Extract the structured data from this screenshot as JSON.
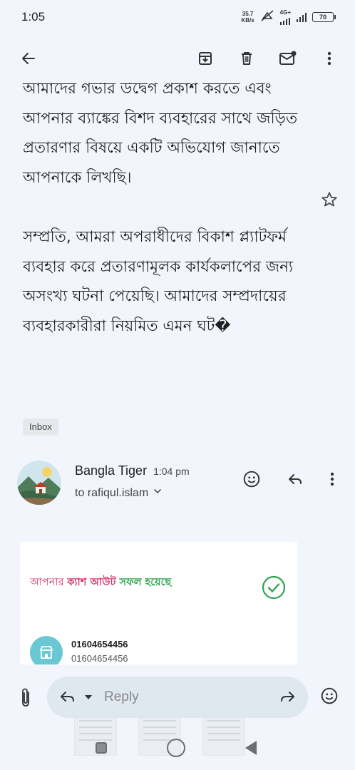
{
  "status_bar": {
    "time": "1:05",
    "net_speed_value": "35.7",
    "net_speed_unit": "KB/s",
    "network_type": "4G+",
    "battery": "70",
    "icons": [
      "mute-icon",
      "signal-4g-icon",
      "signal-icon",
      "battery-icon"
    ]
  },
  "app_bar": {
    "icons": [
      "back-arrow-icon",
      "archive-icon",
      "delete-icon",
      "mark-unread-icon",
      "more-vert-icon"
    ]
  },
  "email": {
    "body_paragraphs": [
      "আমাদের গভীর উদ্বেগ প্রকাশ করতে এবং আপনার ব্যাঙ্কের বিশদ ব্যবহারের সাথে জড়িত প্রতারণার বিষয়ে একটি অভিযোগ জানাতে আপনাকে লিখছি।",
      "সম্প্রতি, আমরা অপরাধীদের বিকাশ প্ল্যাটফর্ম ব্যবহার করে প্রতারণামূলক কার্যকলাপের জন্য অসংখ্য ঘটনা পেয়েছি। আমাদের সম্প্রদায়ের ব্যবহারকারীরা নিয়মিত এমন ঘট�"
    ],
    "label_chip": "Inbox",
    "sender": {
      "name": "Bangla Tiger",
      "time": "1:04 pm",
      "recipient": "to rafiqul.islam"
    },
    "attachment": {
      "banner_part1": "আপনার ",
      "banner_part2": "ক্যাশ আউট",
      "banner_part3": " সফল হয়েছে",
      "phone_primary": "01604654456",
      "phone_secondary": "01604654456"
    }
  },
  "reply_bar": {
    "placeholder": "Reply"
  },
  "colors": {
    "background": "#f2f6fc",
    "reply_pill": "#dfe7ef",
    "banner_pink": "#d6336c",
    "banner_green": "#2ea44f",
    "store_icon_teal": "#6ac7d4"
  }
}
